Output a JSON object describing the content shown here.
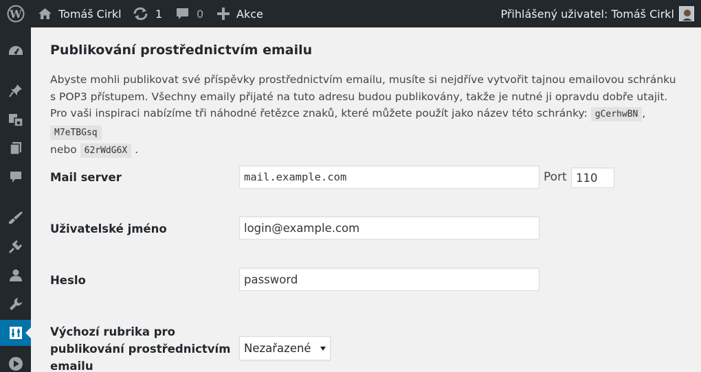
{
  "adminbar": {
    "site_name": "Tomáš Cirkl",
    "updates_count": "1",
    "comments_count": "0",
    "new_label": "Akce",
    "account_text": "Přihlášený uživatel: Tomáš Cirkl"
  },
  "sidebar": {
    "icons": [
      "dashboard-icon",
      "pin-icon",
      "media-icon",
      "pages-icon",
      "comments-icon",
      "appearance-icon",
      "plugins-icon",
      "users-icon",
      "tools-icon",
      "settings-icon",
      "play-icon"
    ],
    "current": "settings-icon"
  },
  "page": {
    "title": "Publikování prostřednictvím emailu",
    "intro_1": "Abyste mohli publikovat své příspěvky prostřednictvím emailu, musíte si nejdříve vytvořit tajnou emailovou schránku s POP3 přístupem. Všechny emaily přijaté na tuto adresu budou publikovány, takže je nutné ji opravdu dobře utajit. Pro vaši inspiraci nabízíme tři náhodné řetězce znaků, které můžete použít jako název této schránky:",
    "code_1": "gCerhwBN",
    "sep_1": ",",
    "code_2": "M7eTBGsq",
    "nebo": "nebo",
    "code_3": "62rWdG6X",
    "end": "."
  },
  "form": {
    "mail_server_label": "Mail server",
    "mail_server_value": "mail.example.com",
    "port_label": "Port",
    "port_value": "110",
    "username_label": "Uživatelské jméno",
    "username_value": "login@example.com",
    "password_label": "Heslo",
    "password_value": "password",
    "category_label_1": "Výchozí rubrika pro",
    "category_label_2": "publikování prostřednictvím",
    "category_label_3": "emailu",
    "category_value": "Nezařazené"
  },
  "colors": {
    "adminbar_bg": "#23282d",
    "accent": "#0073aa",
    "page_bg": "#f1f1f1"
  }
}
